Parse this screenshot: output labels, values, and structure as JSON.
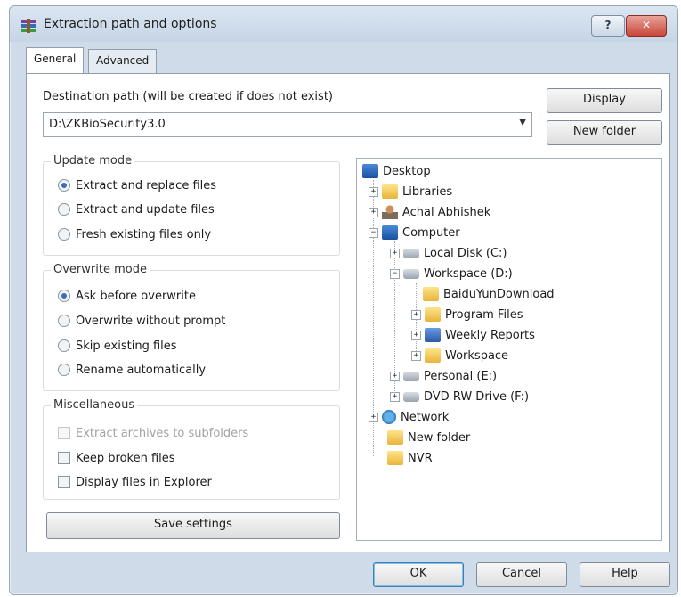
{
  "window": {
    "title": "Extraction path and options",
    "help_label": "?",
    "close_label": "✕"
  },
  "tabs": [
    {
      "label": "General"
    },
    {
      "label": "Advanced"
    }
  ],
  "destination": {
    "label": "Destination path (will be created if does not exist)",
    "value": "D:\\ZKBioSecurity3.0"
  },
  "buttons": {
    "display": "Display",
    "new_folder": "New folder",
    "save_settings": "Save settings",
    "ok": "OK",
    "cancel": "Cancel",
    "help": "Help"
  },
  "update_mode": {
    "title": "Update mode",
    "options": [
      "Extract and replace files",
      "Extract and update files",
      "Fresh existing files only"
    ],
    "selected": 0
  },
  "overwrite_mode": {
    "title": "Overwrite mode",
    "options": [
      "Ask before overwrite",
      "Overwrite without prompt",
      "Skip existing files",
      "Rename automatically"
    ],
    "selected": 0
  },
  "misc": {
    "title": "Miscellaneous",
    "options": [
      "Extract archives to subfolders",
      "Keep broken files",
      "Display files in Explorer"
    ]
  },
  "tree": {
    "items": [
      "Desktop",
      "Libraries",
      "Achal Abhishek",
      "Computer",
      "Local Disk (C:)",
      "Workspace (D:)",
      "BaiduYunDownload",
      "Program Files",
      "Weekly Reports",
      "Workspace",
      "Personal (E:)",
      "DVD RW Drive (F:)",
      "Network",
      "New folder",
      "NVR"
    ]
  }
}
